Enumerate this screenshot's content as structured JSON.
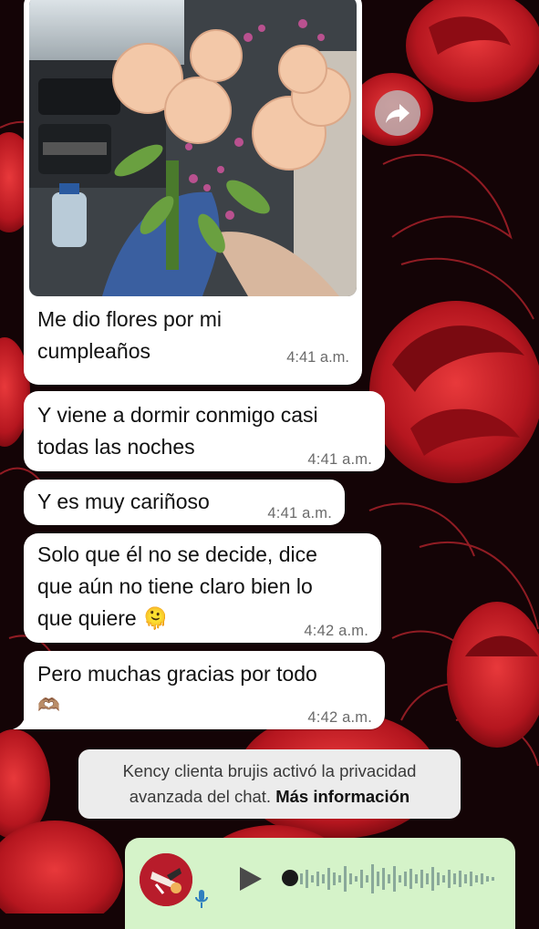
{
  "chat": {
    "messages": [
      {
        "text_lines": [
          "Me dio flores por mi",
          "cumpleaños"
        ],
        "time": "4:41 a.m.",
        "has_photo": true
      },
      {
        "text_lines": [
          "Y viene a dormir conmigo casi",
          "todas las noches"
        ],
        "time": "4:41 a.m."
      },
      {
        "text_lines": [
          "Y es muy cariñoso"
        ],
        "time": "4:41 a.m."
      },
      {
        "text_lines": [
          "Solo que él no se decide, dice",
          "que aún no tiene claro bien lo",
          "que quiere"
        ],
        "emoji": "🫠",
        "time": "4:42 a.m."
      },
      {
        "text_lines": [
          "Pero muchas gracias por todo"
        ],
        "emoji": "🫶🏽",
        "time": "4:42 a.m."
      }
    ],
    "system_notice": {
      "line1": "Kency clienta brujis activó la privacidad",
      "line2_prefix": "avanzada del chat. ",
      "link": "Más información"
    }
  },
  "icons": {
    "forward": "forward-arrow-icon",
    "play": "play-icon",
    "mic": "microphone-icon"
  },
  "colors": {
    "bubble_incoming": "#ffffff",
    "bubble_outgoing": "#d5f3c9",
    "wallpaper_base": "#140406",
    "wallpaper_flower": "#c8202a"
  }
}
